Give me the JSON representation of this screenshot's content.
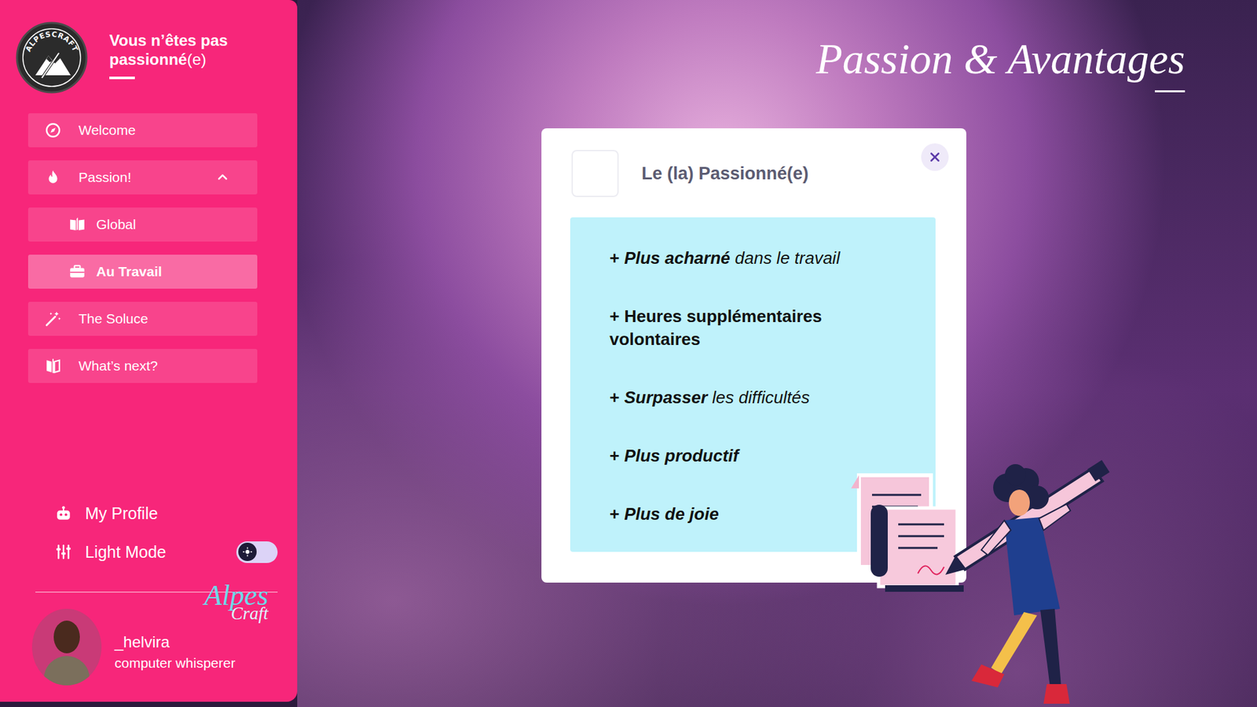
{
  "sidebar": {
    "logo_text": "ALPESCRAFT",
    "title": [
      {
        "text": "Vous n’êtes pas passionné",
        "bold": true
      },
      {
        "text": "(e)",
        "bold": false
      }
    ],
    "items": [
      {
        "label": "Welcome",
        "selected": false,
        "expanded": false,
        "children": []
      },
      {
        "label": "Passion!",
        "selected": false,
        "expanded": true,
        "children": [
          {
            "label": "Global",
            "selected": false
          },
          {
            "label": "Au Travail",
            "selected": true
          }
        ]
      },
      {
        "label": "The Soluce",
        "selected": false,
        "expanded": false,
        "children": []
      },
      {
        "label": "What’s next?",
        "selected": false,
        "expanded": false,
        "children": []
      }
    ],
    "bottom_items": [
      {
        "label": "My Profile",
        "kind": "link"
      },
      {
        "label": "Light Mode",
        "kind": "toggle",
        "on": false
      }
    ],
    "user": {
      "name": "_helvira",
      "role": "computer whisperer"
    },
    "signature": [
      "Alpes",
      "Craft"
    ]
  },
  "page": {
    "title": "Passion & Avantages"
  },
  "modal": {
    "title": "Le (la) Passionné(e)",
    "items": [
      {
        "segments": [
          {
            "text": "+ ",
            "bold": true,
            "italic": false
          },
          {
            "text": "Plus acharné",
            "bold": true,
            "italic": true
          },
          {
            "text": " dans le travail",
            "bold": false,
            "italic": true
          }
        ]
      },
      {
        "segments": [
          {
            "text": "+ Heures supplémentaires volontaires",
            "bold": true,
            "italic": false
          }
        ]
      },
      {
        "segments": [
          {
            "text": "+ ",
            "bold": true,
            "italic": false
          },
          {
            "text": "Surpasser",
            "bold": true,
            "italic": true
          },
          {
            "text": " les difficultés",
            "bold": false,
            "italic": true
          }
        ]
      },
      {
        "segments": [
          {
            "text": "+ ",
            "bold": true,
            "italic": false
          },
          {
            "text": "Plus productif",
            "bold": true,
            "italic": true
          }
        ]
      },
      {
        "segments": [
          {
            "text": "+ ",
            "bold": true,
            "italic": false
          },
          {
            "text": "Plus de joie",
            "bold": true,
            "italic": true
          }
        ]
      }
    ]
  }
}
